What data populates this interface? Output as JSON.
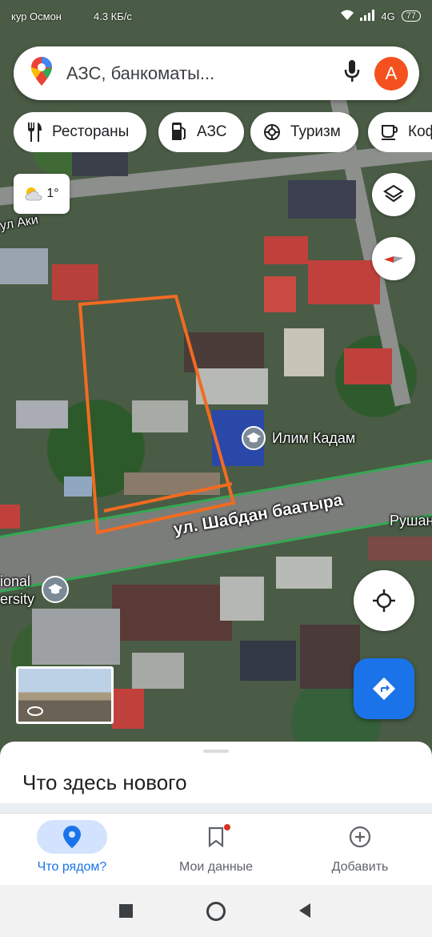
{
  "status_bar": {
    "left_text": "кур Осмон",
    "speed": "4.3 КБ/с",
    "network": "4G",
    "battery": "77"
  },
  "search": {
    "placeholder": "АЗС, банкоматы...",
    "avatar_letter": "А"
  },
  "chips": [
    {
      "label": "Рестораны",
      "icon": "fork-knife-icon"
    },
    {
      "label": "АЗС",
      "icon": "gas-station-icon"
    },
    {
      "label": "Туризм",
      "icon": "camera-icon"
    },
    {
      "label": "Коф",
      "icon": "coffee-icon"
    }
  ],
  "weather": {
    "temperature": "1°",
    "icon": "partly-cloudy-icon"
  },
  "map": {
    "street_main": "ул. Шабдан баатыра",
    "street_top": "ул Аки",
    "street_right": "Рушан",
    "poi_school": "Илим Кадам",
    "university_partial_1": "ional",
    "university_partial_2": "ersity",
    "highlight_color": "#f26b21",
    "road_outline_color": "#34a853"
  },
  "bottom_sheet": {
    "title": "Что здесь нового"
  },
  "bottom_nav": [
    {
      "label": "Что рядом?",
      "icon": "location-pin-icon",
      "active": true
    },
    {
      "label": "Мои данные",
      "icon": "bookmark-icon",
      "active": false
    },
    {
      "label": "Добавить",
      "icon": "add-circle-icon",
      "active": false
    }
  ],
  "colors": {
    "accent": "#1a73e8",
    "avatar": "#f4511e"
  }
}
